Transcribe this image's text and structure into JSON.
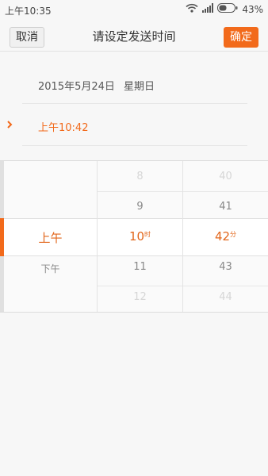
{
  "status_bar": {
    "time": "上午10:35",
    "battery_percent": "43%",
    "icons": [
      "wifi-icon",
      "signal-icon",
      "battery-icon"
    ]
  },
  "header": {
    "cancel_label": "取消",
    "title": "请设定发送时间",
    "confirm_label": "确定"
  },
  "schedule": {
    "date": "2015年5月24日",
    "weekday": "星期日",
    "time": "上午10:42"
  },
  "picker": {
    "ampm": {
      "selected": "上午",
      "below": "下午"
    },
    "hour": {
      "above2": "8",
      "above1": "9",
      "selected": "10",
      "unit": "时",
      "below1": "11",
      "below2": "12"
    },
    "minute": {
      "above2": "40",
      "above1": "41",
      "selected": "42",
      "unit": "分",
      "below1": "43",
      "below2": "44"
    }
  },
  "colors": {
    "accent": "#f26a1b",
    "background": "#f7f7f7"
  }
}
